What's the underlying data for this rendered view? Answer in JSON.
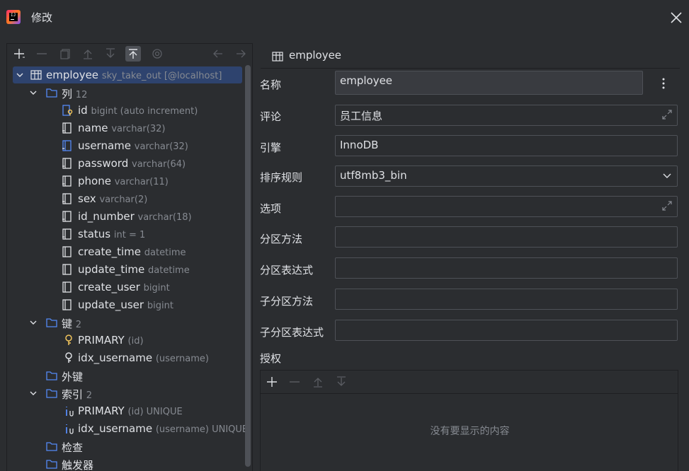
{
  "window": {
    "title": "修改"
  },
  "tree": {
    "root": {
      "name": "employee",
      "meta": "sky_take_out [@localhost]"
    },
    "columns_folder": {
      "label": "列",
      "count": "12"
    },
    "columns": [
      {
        "name": "id",
        "meta": "bigint (auto increment)",
        "icon": "primary-key-column-icon"
      },
      {
        "name": "name",
        "meta": "varchar(32)",
        "icon": "not-null-column-icon"
      },
      {
        "name": "username",
        "meta": "varchar(32)",
        "icon": "unique-column-icon"
      },
      {
        "name": "password",
        "meta": "varchar(64)",
        "icon": "not-null-column-icon"
      },
      {
        "name": "phone",
        "meta": "varchar(11)",
        "icon": "not-null-column-icon"
      },
      {
        "name": "sex",
        "meta": "varchar(2)",
        "icon": "not-null-column-icon"
      },
      {
        "name": "id_number",
        "meta": "varchar(18)",
        "icon": "not-null-column-icon"
      },
      {
        "name": "status",
        "meta": "int = 1",
        "icon": "not-null-column-icon"
      },
      {
        "name": "create_time",
        "meta": "datetime",
        "icon": "column-icon"
      },
      {
        "name": "update_time",
        "meta": "datetime",
        "icon": "column-icon"
      },
      {
        "name": "create_user",
        "meta": "bigint",
        "icon": "column-icon"
      },
      {
        "name": "update_user",
        "meta": "bigint",
        "icon": "column-icon"
      }
    ],
    "keys_folder": {
      "label": "键",
      "count": "2"
    },
    "keys": [
      {
        "name": "PRIMARY",
        "meta": "(id)"
      },
      {
        "name": "idx_username",
        "meta": "(username)"
      }
    ],
    "foreign_keys_folder": {
      "label": "外键"
    },
    "indexes_folder": {
      "label": "索引",
      "count": "2"
    },
    "indexes": [
      {
        "name": "PRIMARY",
        "meta": "(id) UNIQUE"
      },
      {
        "name": "idx_username",
        "meta": "(username) UNIQUE"
      }
    ],
    "checks_folder": {
      "label": "检查"
    },
    "triggers_folder": {
      "label": "触发器"
    }
  },
  "form": {
    "header": "employee",
    "name_label": "名称",
    "name_value": "employee",
    "comment_label": "评论",
    "comment_value": "员工信息",
    "engine_label": "引擎",
    "engine_value": "InnoDB",
    "collation_label": "排序规则",
    "collation_value": "utf8mb3_bin",
    "options_label": "选项",
    "options_value": "",
    "partition_method_label": "分区方法",
    "partition_method_value": "",
    "partition_expr_label": "分区表达式",
    "partition_expr_value": "",
    "subpartition_method_label": "子分区方法",
    "subpartition_method_value": "",
    "subpartition_expr_label": "子分区表达式",
    "subpartition_expr_value": "",
    "grants_label": "授权",
    "grants_empty": "没有要显示的内容"
  },
  "colors": {
    "folder": "#548af7",
    "key_gold": "#f2c55c",
    "selected": "#2e436e",
    "index": "#548af7"
  }
}
